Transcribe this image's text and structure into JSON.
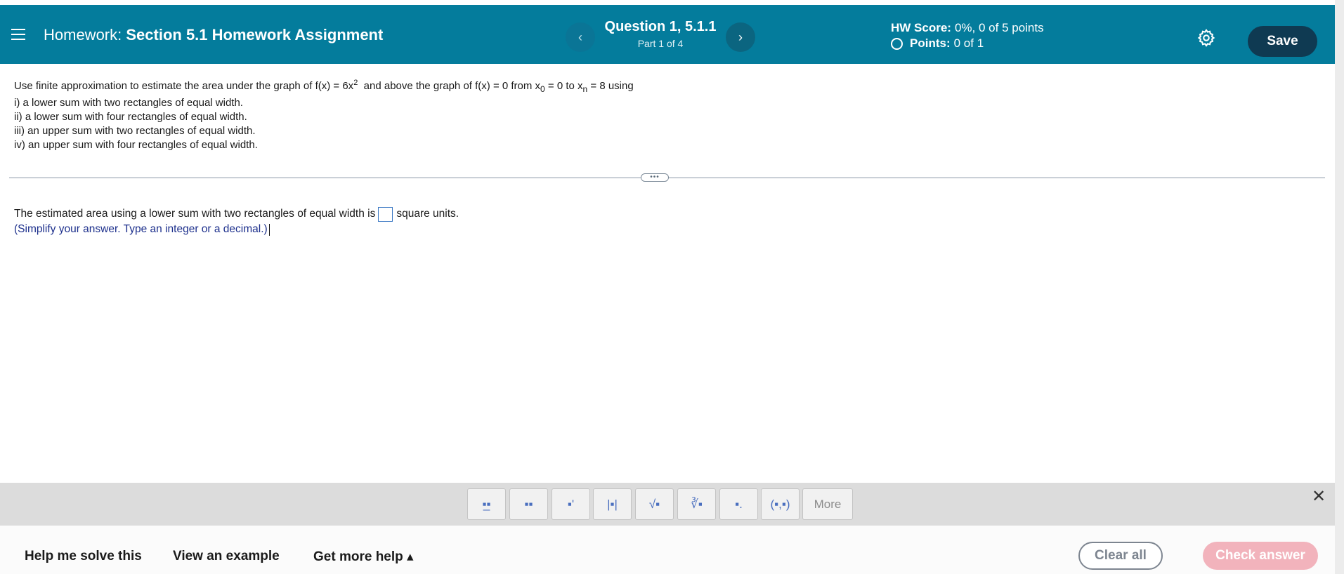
{
  "header": {
    "menu_icon": "hamburger-menu-icon",
    "title_prefix": "Homework:",
    "title": "Section 5.1 Homework Assignment",
    "prev_glyph": "‹",
    "next_glyph": "›",
    "question_label": "Question 1, 5.1.1",
    "part_label": "Part 1 of 4",
    "hw_score_label": "HW Score:",
    "hw_score_value": "0%, 0 of 5 points",
    "points_label": "Points:",
    "points_value": "0 of 1",
    "settings_icon": "gear-icon",
    "save_label": "Save",
    "color": "#047c9c"
  },
  "question": {
    "intro_a": "Use finite approximation to estimate the area under the graph of f(x) = 6x",
    "intro_exp": "2",
    "intro_b": "and above the graph of f(x) = 0 from x",
    "intro_sub0": "0",
    "intro_c": "= 0 to x",
    "intro_subn": "n",
    "intro_d": "= 8 using",
    "items": [
      "i) a lower sum with two rectangles of equal width.",
      "ii) a lower sum with four rectangles of equal width.",
      "iii) an upper sum with two rectangles of equal width.",
      "iv) an upper sum with four rectangles of equal width."
    ]
  },
  "divider": {
    "handle_glyph": "•••"
  },
  "answer": {
    "prefix": "The estimated area using a lower sum with two rectangles of equal width is",
    "value": "",
    "suffix": "square units.",
    "hint": "(Simplify your answer. Type an integer or a decimal.)"
  },
  "palette": {
    "buttons": [
      {
        "name": "fraction-button",
        "glyph": "▪̲▪"
      },
      {
        "name": "mixed-number-button",
        "glyph": "▪▪"
      },
      {
        "name": "exponent-button",
        "glyph": "▪'"
      },
      {
        "name": "absolute-value-button",
        "glyph": "|▪|"
      },
      {
        "name": "square-root-button",
        "glyph": "√▪"
      },
      {
        "name": "nth-root-button",
        "glyph": "∛▪"
      },
      {
        "name": "subscript-button",
        "glyph": "▪."
      },
      {
        "name": "ordered-pair-button",
        "glyph": "(▪,▪)"
      }
    ],
    "more_label": "More",
    "close_glyph": "✕"
  },
  "footer": {
    "help_solve": "Help me solve this",
    "view_example": "View an example",
    "get_more_help": "Get more help ▴",
    "clear_all": "Clear all",
    "check_answer": "Check answer"
  }
}
